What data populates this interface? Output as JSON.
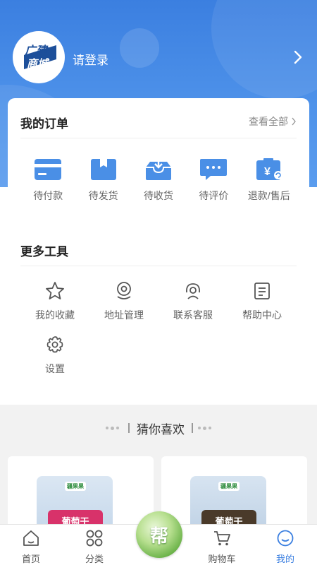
{
  "header": {
    "login_text": "请登录",
    "logo_text": "广建商城"
  },
  "orders": {
    "title": "我的订单",
    "view_all": "查看全部",
    "items": [
      {
        "label": "待付款",
        "icon": "card-icon"
      },
      {
        "label": "待发货",
        "icon": "package-icon"
      },
      {
        "label": "待收货",
        "icon": "receive-box-icon"
      },
      {
        "label": "待评价",
        "icon": "comment-icon"
      },
      {
        "label": "退款/售后",
        "icon": "refund-icon"
      }
    ]
  },
  "tools": {
    "title": "更多工具",
    "items": [
      {
        "label": "我的收藏",
        "icon": "star-icon"
      },
      {
        "label": "地址管理",
        "icon": "location-icon"
      },
      {
        "label": "联系客服",
        "icon": "headset-icon"
      },
      {
        "label": "帮助中心",
        "icon": "document-icon"
      },
      {
        "label": "设置",
        "icon": "gear-icon"
      }
    ]
  },
  "recommend": {
    "title": "猜你喜欢",
    "products": [
      {
        "brand": "疆果果",
        "label": "葡萄干"
      },
      {
        "brand": "疆果果",
        "label": "葡萄干"
      }
    ]
  },
  "tabbar": {
    "items": [
      {
        "label": "首页",
        "icon": "home-icon"
      },
      {
        "label": "分类",
        "icon": "category-icon"
      },
      {
        "label": "购物车",
        "icon": "cart-icon"
      },
      {
        "label": "我的",
        "icon": "profile-icon"
      }
    ],
    "center_label": "帮"
  },
  "colors": {
    "primary": "#3b7fe0",
    "icon_blue": "#4a8fe6"
  }
}
